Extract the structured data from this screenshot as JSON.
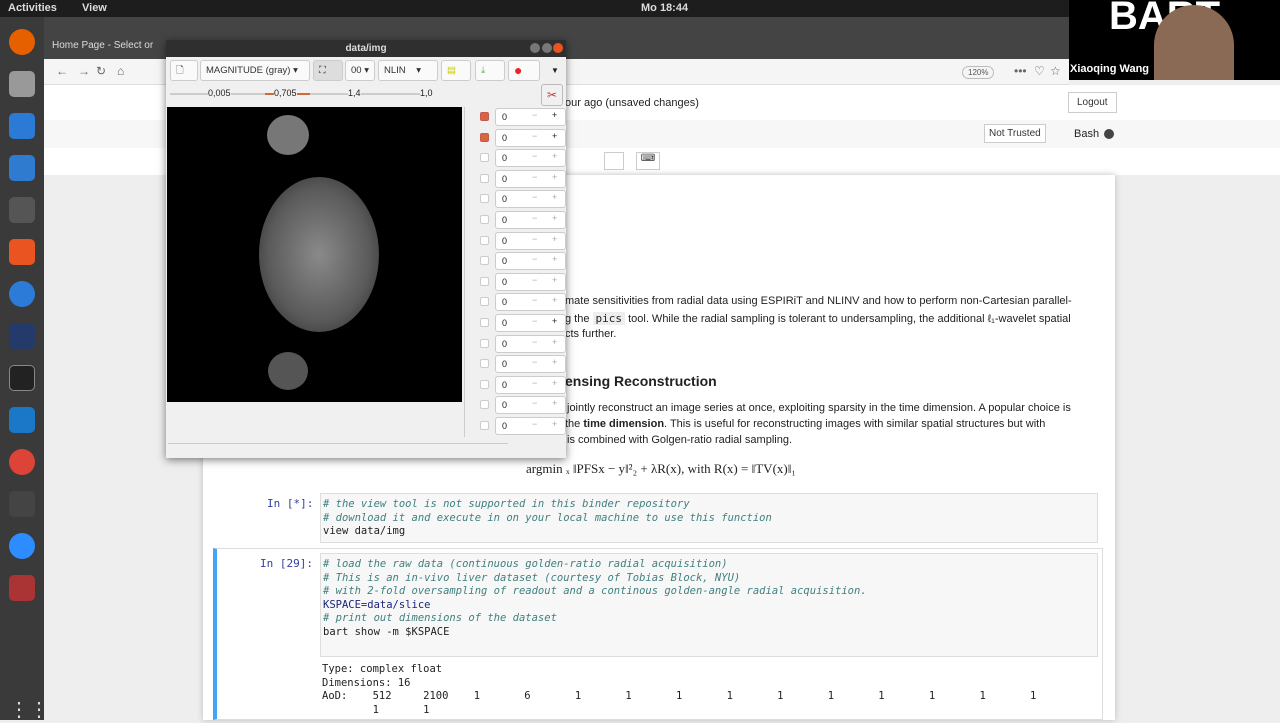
{
  "topbar": {
    "activities": "Activities",
    "view": "View",
    "clock": "Mo 18:44"
  },
  "browser": {
    "tab_title": "Home Page - Select or",
    "zoom": "120%",
    "menu": "•••"
  },
  "jupyter": {
    "save_status": "our ago  (unsaved changes)",
    "logout": "Logout",
    "not_trusted": "Not Trusted",
    "kernel": "Bash"
  },
  "video": {
    "name": "Xiaoqing Wang",
    "logo": "BART"
  },
  "viewer": {
    "title": "data/img",
    "colormap": "MAGNITUDE (gray)",
    "slice_select": "00",
    "mode": "NLIN",
    "sliders": [
      "0,005",
      "0,705",
      "1,4",
      "1,0"
    ],
    "dims": [
      {
        "checked": true,
        "value": "0"
      },
      {
        "checked": true,
        "value": "0"
      },
      {
        "checked": false,
        "value": "0"
      },
      {
        "checked": false,
        "value": "0"
      },
      {
        "checked": false,
        "value": "0"
      },
      {
        "checked": false,
        "value": "0"
      },
      {
        "checked": false,
        "value": "0"
      },
      {
        "checked": false,
        "value": "0"
      },
      {
        "checked": false,
        "value": "0"
      },
      {
        "checked": false,
        "value": "0"
      },
      {
        "checked": false,
        "value": "0"
      },
      {
        "checked": false,
        "value": "0"
      },
      {
        "checked": false,
        "value": "0"
      },
      {
        "checked": false,
        "value": "0"
      },
      {
        "checked": false,
        "value": "0"
      },
      {
        "checked": false,
        "value": "0"
      }
    ]
  },
  "notebook": {
    "para1": [
      "mate sensitivities from radial data using ESPIRiT and NLINV and how to perform non-Cartesian parallel-",
      "g the ",
      "pics",
      " tool. While the radial sampling is tolerant to undersampling, the additional ℓ₁-wavelet spatial",
      "cts further."
    ],
    "heading": "ensing Reconstruction",
    "para2": [
      "jointly reconstruct an image series at once, exploiting sparsity in the time dimension. A popular choice is",
      "the ",
      "time dimension",
      ". This is useful for reconstructing images with similar spatial structures but with",
      "is combined with Golgen-ratio radial sampling."
    ],
    "formula": "argmin ₓ   ‖PFSx − y‖²₂ + λR(x),    with    R(x) = ‖TV(x)‖₁",
    "cell1": {
      "prompt": "In [*]:",
      "lines": [
        "# the view tool is not supported in this binder repository",
        "# download it and execute in on your local machine to use this function",
        "view data/img"
      ]
    },
    "cell2": {
      "prompt": "In [29]:",
      "lines": [
        "# load the raw data (continuous golden-ratio radial acquisition)",
        "# This is an in-vivo liver dataset (courtesy of Tobias Block, NYU)",
        "# with 2-fold oversampling of readout and a continous golden-angle radial acquisition.",
        "KSPACE=data/slice",
        "",
        "# print out dimensions of the dataset",
        "bart show -m $KSPACE"
      ],
      "output": [
        "Type: complex float",
        "Dimensions: 16",
        "AoD:    512     2100    1       6       1       1       1       1       1       1       1       1       1       1",
        "        1       1"
      ]
    }
  }
}
